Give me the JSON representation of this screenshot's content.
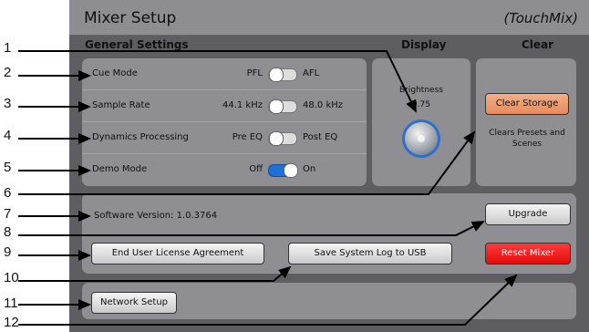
{
  "window": {
    "title": "Mixer Setup",
    "brand": "(TouchMix)"
  },
  "headers": {
    "general": "General Settings",
    "display": "Display",
    "clear": "Clear"
  },
  "settings": [
    {
      "label": "Cue Mode",
      "left": "PFL",
      "right": "AFL",
      "on": false
    },
    {
      "label": "Sample Rate",
      "left": "44.1 kHz",
      "right": "48.0 kHz",
      "on": false
    },
    {
      "label": "Dynamics Processing",
      "left": "Pre EQ",
      "right": "Post EQ",
      "on": false
    },
    {
      "label": "Demo Mode",
      "left": "Off",
      "right": "On",
      "on": true
    }
  ],
  "display": {
    "label": "Brightness",
    "value": "0.75"
  },
  "clear": {
    "button": "Clear Storage",
    "desc": "Clears Presets and Scenes"
  },
  "software": {
    "version_text": "Software Version: 1.0.3764",
    "upgrade": "Upgrade",
    "eula": "End User License Agreement",
    "save_log": "Save System Log to USB",
    "reset": "Reset Mixer"
  },
  "network": {
    "button": "Network Setup"
  },
  "callouts": [
    "1",
    "2",
    "3",
    "4",
    "5",
    "6",
    "7",
    "8",
    "9",
    "10",
    "11",
    "12"
  ],
  "colors": {
    "accent": "#1e6fd6",
    "clear": "#e98f60",
    "reset": "#ff1f1f"
  }
}
